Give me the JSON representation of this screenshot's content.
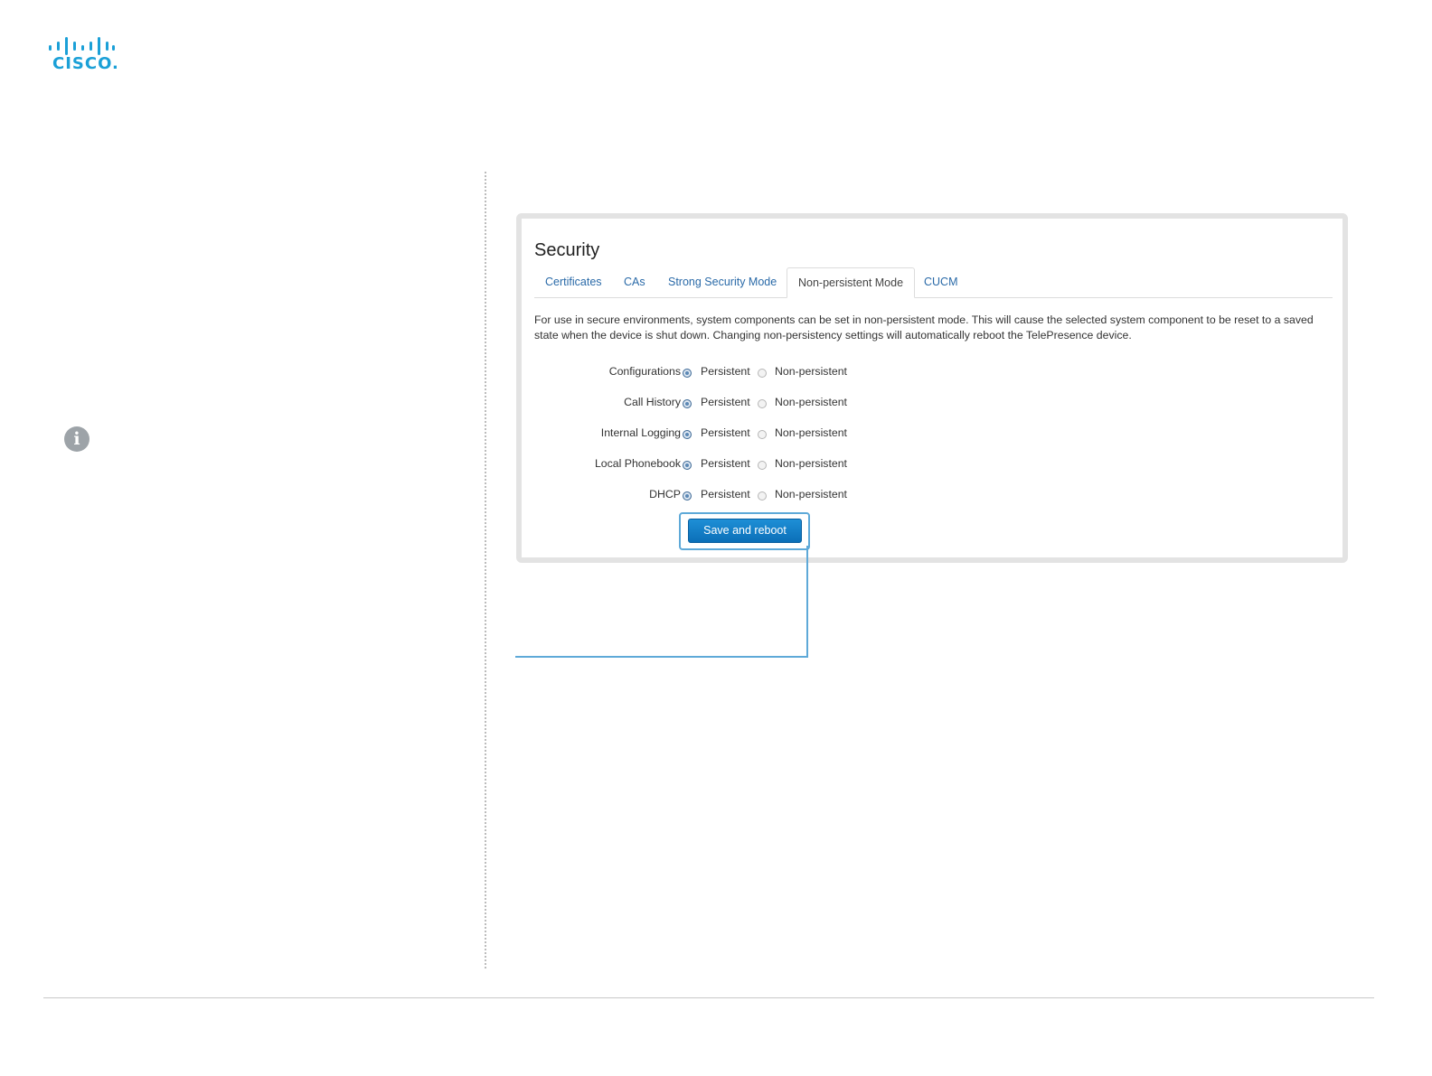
{
  "brand": {
    "name": "CISCO.",
    "color": "#1ba0d7"
  },
  "sidebar": {
    "info_icon": "i"
  },
  "security": {
    "title": "Security",
    "tabs": [
      {
        "label": "Certificates",
        "active": false
      },
      {
        "label": "CAs",
        "active": false
      },
      {
        "label": "Strong Security Mode",
        "active": false
      },
      {
        "label": "Non-persistent Mode",
        "active": true
      },
      {
        "label": "CUCM",
        "active": false
      }
    ],
    "description": "For use in secure environments, system components can be set in non-persistent mode. This will cause the selected system component to be reset to a saved state when the device is shut down. Changing non-persistency settings will automatically reboot the TelePresence device.",
    "options": {
      "persistent": "Persistent",
      "non_persistent": "Non-persistent"
    },
    "rows": [
      {
        "label": "Configurations",
        "selected": "Persistent"
      },
      {
        "label": "Call History",
        "selected": "Persistent"
      },
      {
        "label": "Internal Logging",
        "selected": "Persistent"
      },
      {
        "label": "Local Phonebook",
        "selected": "Persistent"
      },
      {
        "label": "DHCP",
        "selected": "Persistent"
      }
    ],
    "save_button": "Save and reboot"
  },
  "colors": {
    "accent": "#1e8fd6",
    "callout": "#5ea9d8",
    "link": "#2a6aa8"
  }
}
